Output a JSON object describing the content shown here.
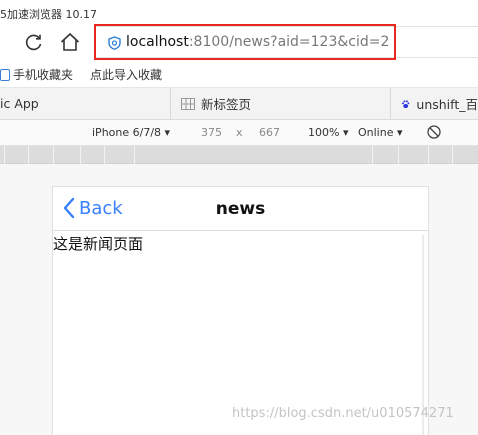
{
  "window": {
    "title": "5加速浏览器 10.17"
  },
  "navigation": {
    "url_host": "localhost",
    "url_rest": ":8100/news?aid=123&cid=2"
  },
  "bookmarks": [
    {
      "label": "手机收藏夹"
    },
    {
      "label": "点此导入收藏"
    }
  ],
  "tabs": [
    {
      "label": "ic App"
    },
    {
      "label": "新标签页"
    },
    {
      "label": "unshift_百"
    }
  ],
  "device_toolbar": {
    "device": "iPhone 6/7/8 ▾",
    "width": "375",
    "times": "x",
    "height": "667",
    "zoom": "100% ▾",
    "network": "Online ▾"
  },
  "app": {
    "back_label": "Back",
    "title": "news",
    "body_text": "这是新闻页面",
    "accent": "#3880ff"
  },
  "watermark": "https://blog.csdn.net/u010574271",
  "colors": {
    "highlight": "#e8271e",
    "link_blue": "#3880ff"
  }
}
